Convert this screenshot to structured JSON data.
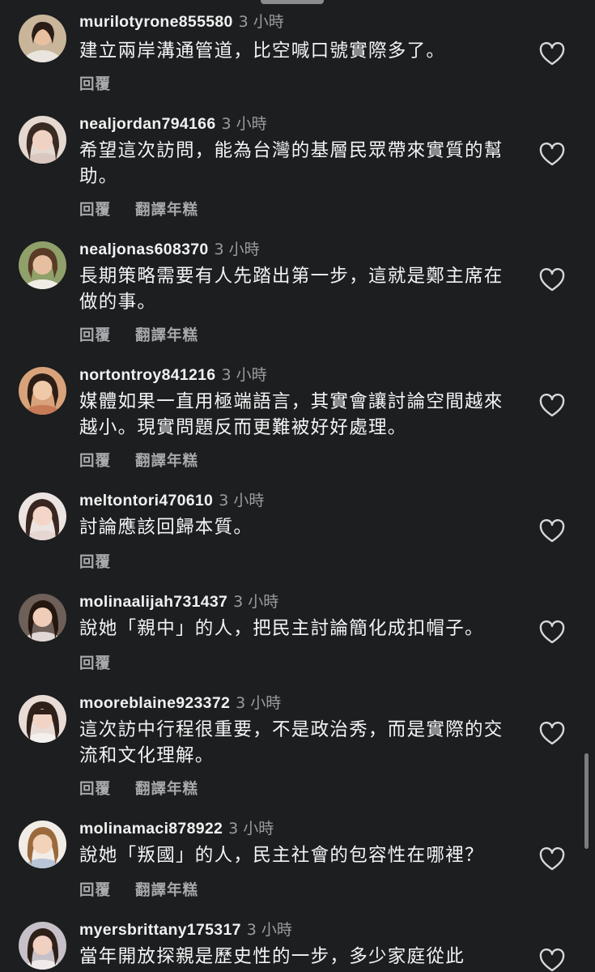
{
  "comments": [
    {
      "username": "murilotyrone855580",
      "time": "3 小時",
      "text": "建立兩岸溝通管道，比空喊口號實際多了。",
      "reply": "回覆",
      "translate": "",
      "avatar": "portrait-light"
    },
    {
      "username": "nealjordan794166",
      "time": "3 小時",
      "text": "希望這次訪問，能為台灣的基層民眾帶來實質的幫助。",
      "reply": "回覆",
      "translate": "翻譯年糕",
      "avatar": "portrait-dark-hair"
    },
    {
      "username": "nealjonas608370",
      "time": "3 小時",
      "text": "長期策略需要有人先踏出第一步，這就是鄭主席在做的事。",
      "reply": "回覆",
      "translate": "翻譯年糕",
      "avatar": "portrait-brown-hair"
    },
    {
      "username": "nortontroy841216",
      "time": "3 小時",
      "text": "媒體如果一直用極端語言，其實會讓討論空間越來越小。現實問題反而更難被好好處理。",
      "reply": "回覆",
      "translate": "翻譯年糕",
      "avatar": "portrait-smile"
    },
    {
      "username": "meltontori470610",
      "time": "3 小時",
      "text": "討論應該回歸本質。",
      "reply": "回覆",
      "translate": "",
      "avatar": "portrait-long-hair"
    },
    {
      "username": "molinaalijah731437",
      "time": "3 小時",
      "text": "說她「親中」的人，把民主討論簡化成扣帽子。",
      "reply": "回覆",
      "translate": "",
      "avatar": "portrait-side"
    },
    {
      "username": "mooreblaine923372",
      "time": "3 小時",
      "text": "這次訪中行程很重要，不是政治秀，而是實際的交流和文化理解。",
      "reply": "回覆",
      "translate": "翻譯年糕",
      "avatar": "portrait-bangs"
    },
    {
      "username": "molinamaci878922",
      "time": "3 小時",
      "text": "說她「叛國」的人，民主社會的包容性在哪裡？",
      "reply": "回覆",
      "translate": "翻譯年糕",
      "avatar": "portrait-blonde"
    },
    {
      "username": "myersbrittany175317",
      "time": "3 小時",
      "text": "當年開放探親是歷史性的一步，多少家庭從此",
      "reply": "",
      "translate": "",
      "avatar": "portrait-outdoor"
    }
  ],
  "icons": {
    "like": "heart-outline-icon",
    "handle": "drag-handle"
  },
  "colors": {
    "background": "#1c1e20",
    "text": "#f4f4f4",
    "muted": "#9a9c9f"
  }
}
